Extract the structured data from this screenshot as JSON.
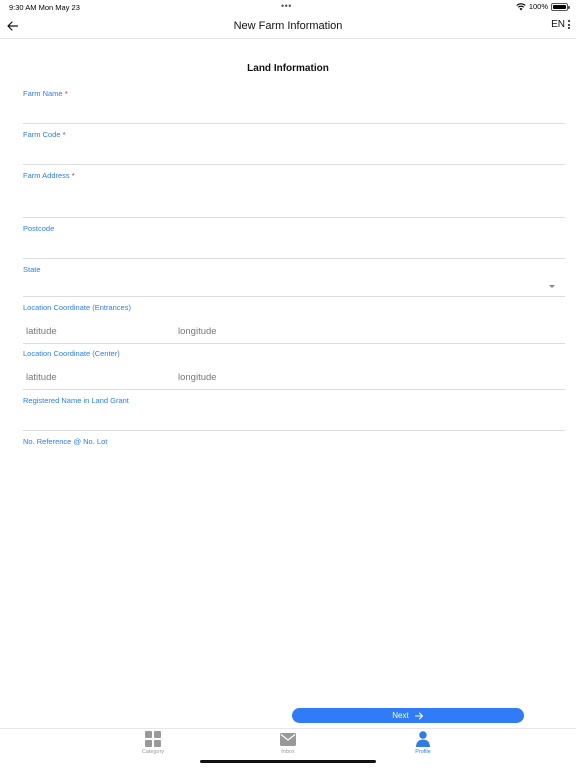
{
  "status_bar": {
    "time": "9:30 AM  Mon May 23",
    "battery": "100%"
  },
  "header": {
    "title": "New Farm Information",
    "language": "EN"
  },
  "section": {
    "title": "Land Information"
  },
  "form": {
    "farm_name": {
      "label": "Farm Name",
      "required": "*",
      "value": ""
    },
    "farm_code": {
      "label": "Farm Code",
      "required": "*",
      "value": ""
    },
    "farm_address": {
      "label": "Farm Address",
      "required": "*",
      "value": ""
    },
    "postcode": {
      "label": "Postcode",
      "value": ""
    },
    "state": {
      "label": "State",
      "value": ""
    },
    "coord_entrances": {
      "label": "Location Coordinate (Entrances)",
      "lat_placeholder": "latitude",
      "lng_placeholder": "longitude"
    },
    "coord_center": {
      "label": "Location Coordinate (Center)",
      "lat_placeholder": "latitude",
      "lng_placeholder": "longitude"
    },
    "registered_name": {
      "label": "Registered Name in Land Grant",
      "value": ""
    },
    "reference_lot": {
      "label": "No. Reference @ No. Lot",
      "value": ""
    }
  },
  "actions": {
    "next_label": "Next"
  },
  "tab_bar": {
    "tabs": [
      {
        "label": "Category",
        "icon": "grid-icon",
        "active": false
      },
      {
        "label": "Inbox",
        "icon": "envelope-icon",
        "active": false
      },
      {
        "label": "Profile",
        "icon": "person-icon",
        "active": true
      }
    ]
  },
  "colors": {
    "accent": "#2f7de1",
    "button": "#2f7cf6",
    "required": "#e02020",
    "inactive": "#999999"
  }
}
